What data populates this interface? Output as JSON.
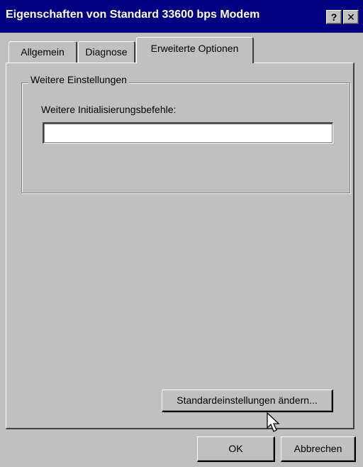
{
  "window": {
    "title": "Eigenschaften von Standard 33600 bps Modem",
    "help_label": "?",
    "close_label": "✕"
  },
  "tabs": [
    {
      "label": "Allgemein",
      "active": false
    },
    {
      "label": "Diagnose",
      "active": false
    },
    {
      "label": "Erweiterte Optionen",
      "active": true
    }
  ],
  "group": {
    "legend": "Weitere Einstellungen",
    "field_label": "Weitere Initialisierungsbefehle:",
    "field_value": ""
  },
  "buttons": {
    "change_defaults": "Standardeinstellungen ändern...",
    "ok": "OK",
    "cancel": "Abbrechen"
  },
  "colors": {
    "titlebar": "#000080",
    "face": "#c0c0c0"
  }
}
